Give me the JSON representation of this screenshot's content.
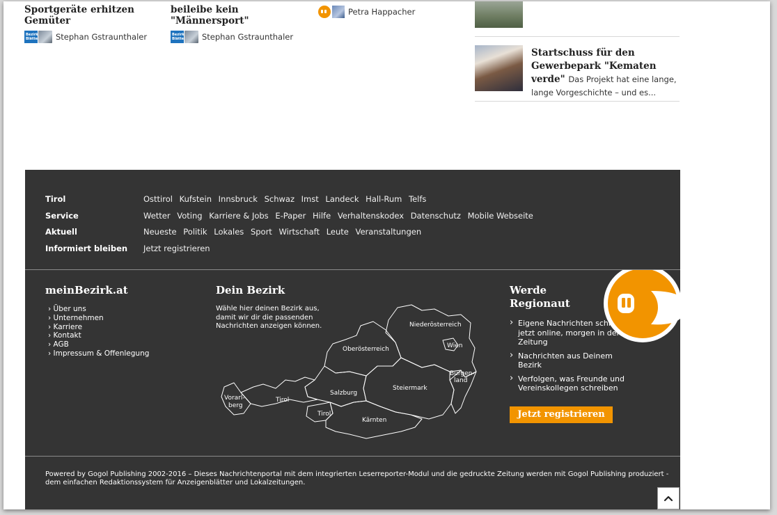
{
  "articles": [
    {
      "title": "Sportgeräte erhitzen Gemüter",
      "badge": "Bezirks Blätter",
      "author": "Stephan Gstraunthaler"
    },
    {
      "title": "beileibe kein \"Männersport\"",
      "badge": "Bezirks Blätter",
      "author": "Stephan Gstraunthaler"
    },
    {
      "title": "",
      "author": "Petra Happacher"
    }
  ],
  "right_article": {
    "title": "Startschuss für den Gewerbepark \"Kematen verde\"",
    "snippet": "Das Projekt hat eine lange, lange Vorgeschichte – und es..."
  },
  "footer_nav": [
    {
      "label": "Tirol",
      "links": [
        "Osttirol",
        "Kufstein",
        "Innsbruck",
        "Schwaz",
        "Imst",
        "Landeck",
        "Hall-Rum",
        "Telfs"
      ]
    },
    {
      "label": "Service",
      "links": [
        "Wetter",
        "Voting",
        "Karriere & Jobs",
        "E-Paper",
        "Hilfe",
        "Verhaltenskodex",
        "Datenschutz",
        "Mobile Webseite"
      ]
    },
    {
      "label": "Aktuell",
      "links": [
        "Neueste",
        "Politik",
        "Lokales",
        "Sport",
        "Wirtschaft",
        "Leute",
        "Veranstaltungen"
      ]
    },
    {
      "label": "Informiert bleiben",
      "links": [
        "Jetzt registrieren"
      ]
    }
  ],
  "meinbezirk": {
    "title": "meinBezirk.at",
    "links": [
      "Über uns",
      "Unternehmen",
      "Karriere",
      "Kontakt",
      "AGB",
      "Impressum & Offenlegung"
    ]
  },
  "dein_bezirk": {
    "title": "Dein Bezirk",
    "text": "Wähle hier deinen Bezirk aus, damit wir dir die passenden Nachrichten anzeigen können.",
    "regions": [
      "Niederösterreich",
      "Wien",
      "Oberösterreich",
      "Burgen-",
      "land",
      "Steiermark",
      "Salzburg",
      "Vorarl-",
      "berg",
      "Tirol",
      "Tirol",
      "Kärnten"
    ]
  },
  "regionaut": {
    "title_line1": "Werde",
    "title_line2": "Regionaut",
    "items": [
      "Eigene Nachrichten schreiben - jetzt online, morgen in der Zeitung",
      "Nachrichten aus Deinem Bezirk",
      "Verfolgen, was Freunde und Vereinskollegen schreiben"
    ],
    "button": "Jetzt registrieren",
    "accent": "#f29400"
  },
  "powered_by": "Powered by Gogol Publishing 2002-2016 – Dieses Nachrichtenportal mit dem integrierten Leserreporter-Modul und die gedruckte Zeitung werden mit Gogol Publishing produziert - dem einfachen Redaktionssystem für Anzeigenblätter und Lokalzeitungen.",
  "icons": {
    "scroll_top": "chevron-up-icon"
  }
}
